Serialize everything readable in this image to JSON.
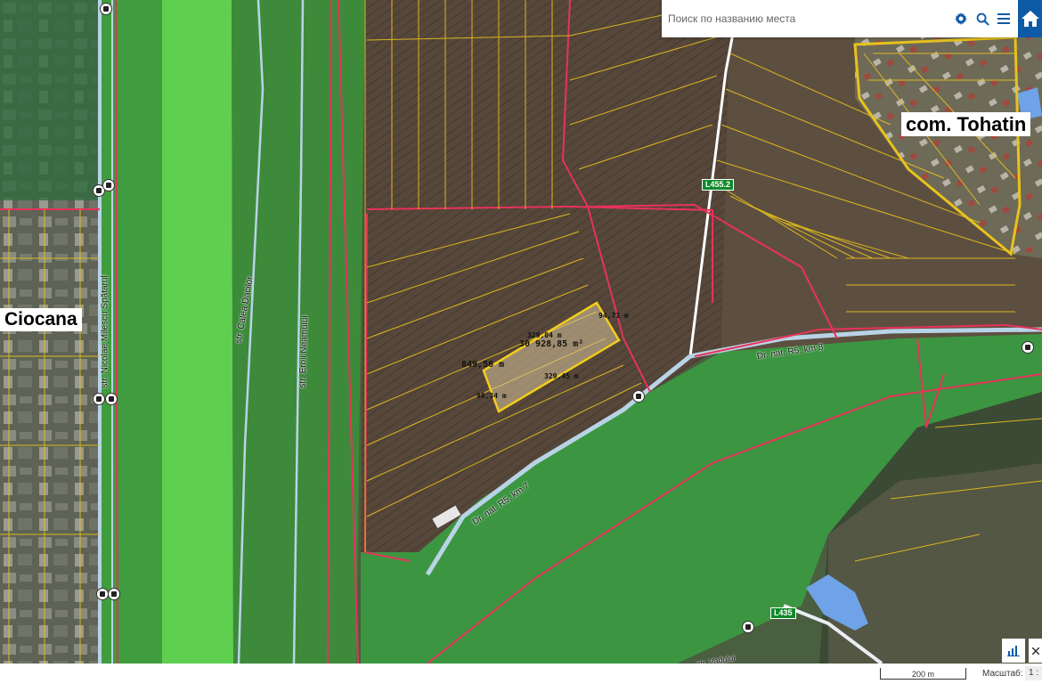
{
  "search": {
    "placeholder": "Поиск по названию места"
  },
  "icons": {
    "settings": "gear-icon",
    "search": "search-icon",
    "menu": "menu-icon",
    "home": "home-icon"
  },
  "places": {
    "ciocana": "Ciocana",
    "tohatin": "com. Tohatin"
  },
  "streets": {
    "milescu": "str. Nicolae Milescu Spătarul",
    "calea_dacilor": "str. Calea Dacilor",
    "eroii": "str. Eroii Neamului",
    "r5_km8": "Dr. nat. R5, km 8",
    "r5_km7": "Dr. nat. R5, km 7",
    "vadului": "str. Vadului"
  },
  "road_badges": {
    "l455": "L455.2",
    "l435": "L435"
  },
  "measurements": {
    "area": "30 928,85 m²",
    "perimeter": "849,56 m",
    "side_top": "329,04 m",
    "side_bottom": "329,45 m",
    "side_right": "94,73 m",
    "side_left": "96,34 m"
  },
  "scale": {
    "bar": "200 m",
    "label": "Масштаб:",
    "value": "1 :"
  },
  "colors": {
    "forest_green": "#3f9c3f",
    "light_green": "#5fcf50",
    "field_brown": "#57473a",
    "parcel_yellow": "#e8c21c",
    "parcel_red": "#e8325a",
    "brand_blue": "#0d5aa7",
    "road_blue": "#b9d3e6"
  }
}
